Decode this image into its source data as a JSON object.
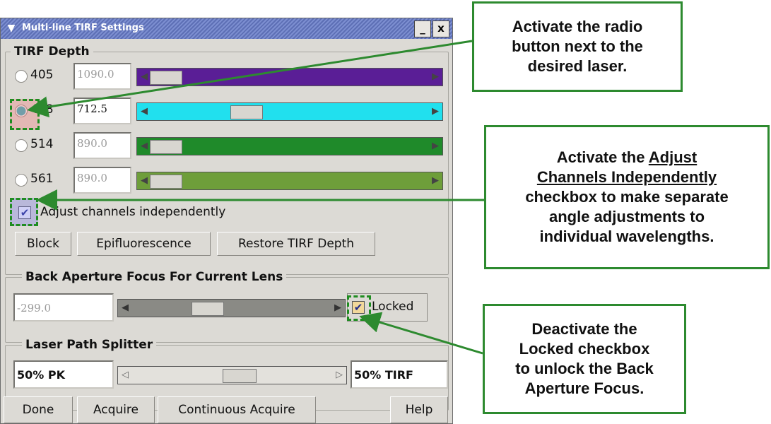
{
  "window": {
    "title": "Multi-line TIRF Settings",
    "minimize_label": "_",
    "close_label": "x"
  },
  "tirf_depth": {
    "legend": "TIRF Depth",
    "lasers": [
      {
        "label": "405",
        "value": "1090.0",
        "selected": false,
        "color": "#5a1e96",
        "position": 0.0
      },
      {
        "label": "488",
        "value": "712.5",
        "selected": true,
        "color": "#21e0ee",
        "position": 0.3
      },
      {
        "label": "514",
        "value": "890.0",
        "selected": false,
        "color": "#1f8a2a",
        "position": 0.0
      },
      {
        "label": "561",
        "value": "890.0",
        "selected": false,
        "color": "#6e9e3a",
        "position": 0.0
      }
    ],
    "adjust_channels_label": "Adjust channels independently",
    "adjust_channels_checked": true,
    "buttons": {
      "block": "Block",
      "epifluorescence": "Epifluorescence",
      "restore": "Restore TIRF Depth"
    }
  },
  "back_aperture": {
    "legend": "Back Aperture Focus For Current Lens",
    "value": "-299.0",
    "locked_label": "Locked",
    "locked_checked": true,
    "position": 0.33
  },
  "splitter": {
    "legend": "Laser Path Splitter",
    "left_label": "50% PK",
    "right_label": "50% TIRF",
    "position": 0.5
  },
  "footer": {
    "done": "Done",
    "acquire": "Acquire",
    "continuous": "Continuous Acquire",
    "help": "Help"
  },
  "callouts": {
    "radio": [
      "Activate the radio",
      "button next to the",
      "desired laser."
    ],
    "adjust": {
      "line1": "Activate the",
      "line2a": "Adjust",
      "line3": "Channels Independently",
      "line4": "checkbox to make separate",
      "line5": "angle adjustments to",
      "line6": "individual wavelengths."
    },
    "locked": [
      "Deactivate the",
      "Locked checkbox",
      "to unlock the Back",
      "Aperture Focus."
    ]
  },
  "colors": {
    "accent_green": "#2d8a2f",
    "title_bar": "#6a7cc0"
  }
}
